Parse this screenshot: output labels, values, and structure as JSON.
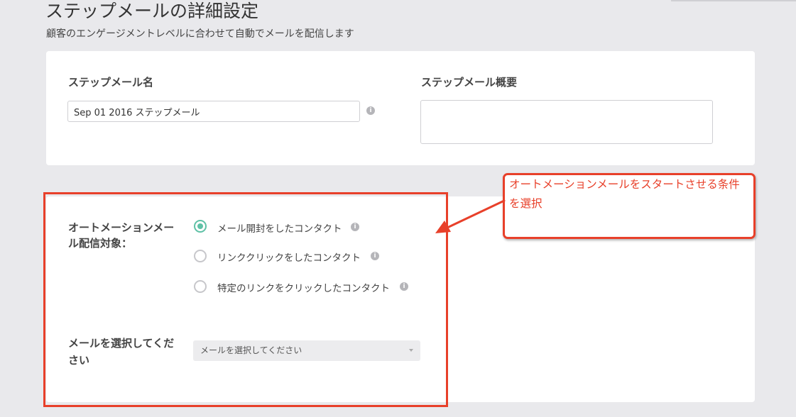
{
  "header": {
    "title": "ステップメールの詳細設定",
    "subtitle": "顧客のエンゲージメントレベルに合わせて自動でメールを配信します"
  },
  "settings": {
    "name_label": "ステップメール名",
    "name_value": "Sep 01 2016 ステップメール",
    "summary_label": "ステップメール概要",
    "summary_value": ""
  },
  "automation": {
    "target_label_line1": "オートメーションメー",
    "target_label_line2": "ル配信対象：",
    "options": [
      {
        "label": "メール開封をしたコンタクト",
        "selected": true
      },
      {
        "label": "リンククリックをしたコンタクト",
        "selected": false
      },
      {
        "label": "特定のリンクをクリックしたコンタクト",
        "selected": false
      }
    ],
    "select_label_line1": "メールを選択してくだ",
    "select_label_line2": "さい",
    "select_placeholder": "メールを選択してください"
  },
  "annotation": {
    "callout_text": "オートメーションメールをスタートさせる条件を選択",
    "color": "#e8402a"
  },
  "icons": {
    "info": "i"
  },
  "colors": {
    "radio_selected": "#5fc1a6",
    "page_background": "#e9e9ec"
  }
}
